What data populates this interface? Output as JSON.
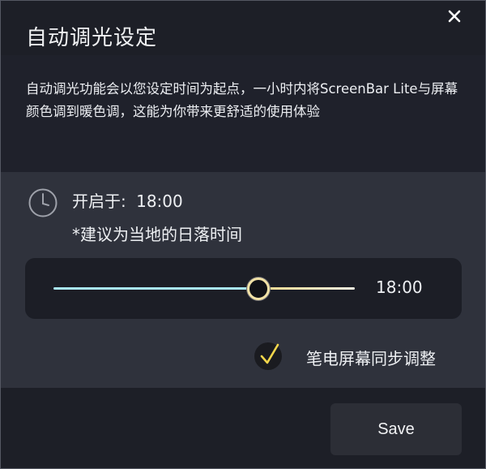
{
  "dialog": {
    "title": "自动调光设定",
    "close_icon": "close-icon"
  },
  "description": "自动调光功能会以您设定时间为起点，一小时内将ScreenBar Lite与屏幕颜色调到暖色调，这能为你带来更舒适的使用体验",
  "schedule": {
    "clock_icon": "clock-icon",
    "start_label": "开启于:",
    "start_time": "18:00",
    "hint": "*建议为当地的日落时间"
  },
  "slider": {
    "value": "18:00",
    "position_fraction": 0.68,
    "colors": {
      "cool": "#a9e6f4",
      "warm": "#f6d98c"
    }
  },
  "sync": {
    "checked": true,
    "label": "笔电屏幕同步调整",
    "check_color": "#f2d64b"
  },
  "footer": {
    "save_label": "Save"
  }
}
